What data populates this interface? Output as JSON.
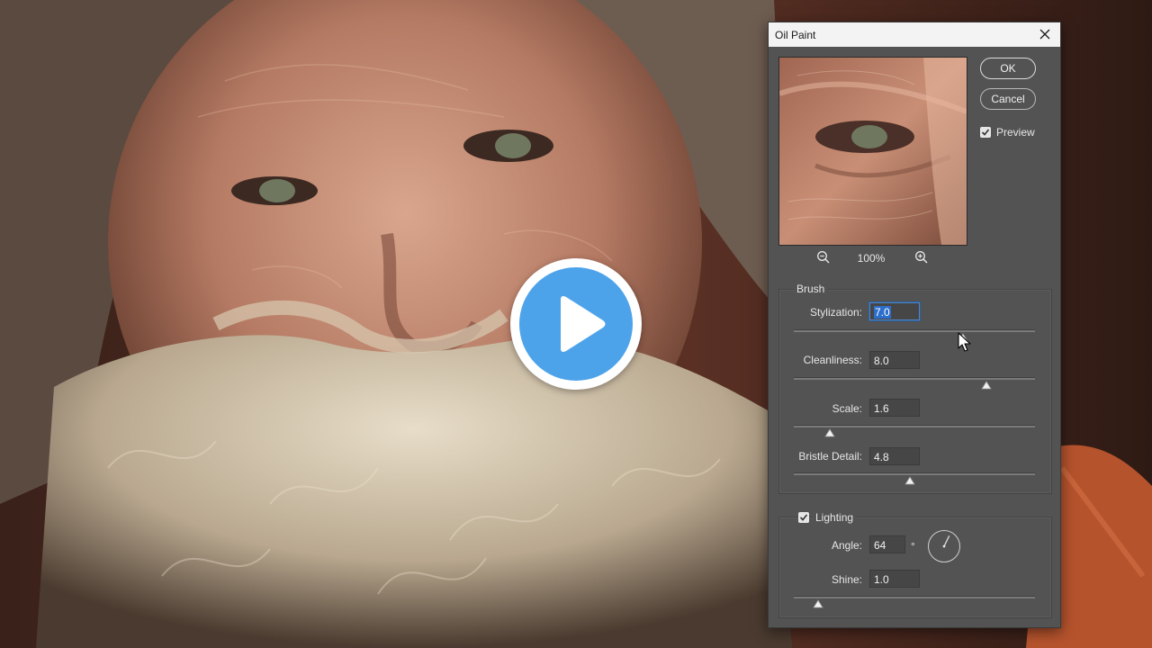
{
  "dialog": {
    "title": "Oil Paint",
    "ok_label": "OK",
    "cancel_label": "Cancel",
    "preview_label": "Preview",
    "preview_checked": true,
    "zoom_level": "100%"
  },
  "brush": {
    "group_title": "Brush",
    "stylization": {
      "label": "Stylization:",
      "value": "7.0",
      "level": 0.7
    },
    "cleanliness": {
      "label": "Cleanliness:",
      "value": "8.0",
      "level": 0.8
    },
    "scale": {
      "label": "Scale:",
      "value": "1.6",
      "level": 0.15
    },
    "bristle_detail": {
      "label": "Bristle Detail:",
      "value": "4.8",
      "level": 0.48
    }
  },
  "lighting": {
    "group_title": "Lighting",
    "checked": true,
    "angle": {
      "label": "Angle:",
      "value": "64",
      "unit": "°"
    },
    "shine": {
      "label": "Shine:",
      "value": "1.0",
      "level": 0.1
    }
  },
  "icons": {
    "close": "close-icon",
    "zoom_out": "zoom-out-icon",
    "zoom_in": "zoom-in-icon",
    "play": "play-icon",
    "cursor": "mouse-cursor-icon"
  },
  "colors": {
    "play_button": "#4da3ea",
    "dialog_bg": "#535353",
    "selection": "#2c6ecb"
  }
}
